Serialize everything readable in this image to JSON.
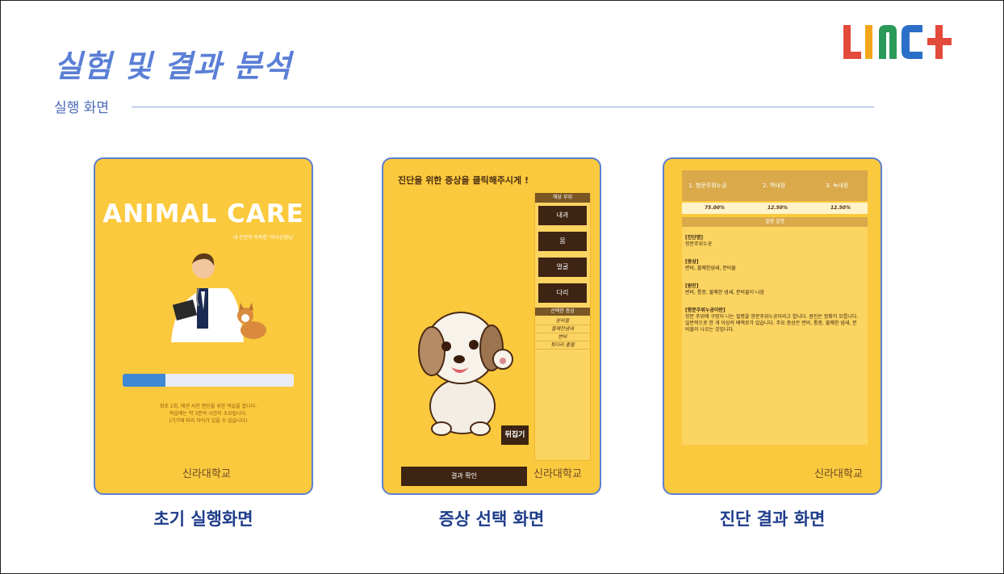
{
  "slide": {
    "title": "실험 및 결과 분석",
    "subtitle": "실행 화면",
    "logo_text": "LINC+"
  },
  "phones": [
    {
      "caption": "초기 실행화면",
      "app_title": "ANIMAL CARE",
      "tagline": "내 손안의 똑똑한 '의사선생님'",
      "progress": 0.25,
      "notes": [
        "최초 1회, 애견 사진 판단을 위한 학습을 합니다.",
        "학습에는 약 3분의 시간이 소요됩니다.",
        "(기기에 따라 차이가 있을 수 있습니다)"
      ],
      "school": "신라대학교"
    },
    {
      "caption": "증상 선택 화면",
      "heading": "진단을 위한 증상을 클릭해주시게 !",
      "part_header": "해당 부위",
      "parts": [
        "내과",
        "몸",
        "얼굴",
        "다리"
      ],
      "symptom_header": "선택한 증상",
      "symptoms": [
        "분비물",
        "불쾌한냄새",
        "변비",
        "뒷다리 출혈"
      ],
      "flip_label": "뒤집기",
      "result_button": "결과 확인",
      "school": "신라대학교"
    },
    {
      "caption": "진단 결과 화면",
      "ranks": [
        "1. 항문주위누공",
        "2. 백내장",
        "3. 녹내장"
      ],
      "probabilities": [
        "75.00%",
        "12.50%",
        "12.50%"
      ],
      "desc_header": "질병 설명",
      "sections": [
        {
          "title": "[진단명]",
          "body": "항문주위누공"
        },
        {
          "title": "[증상]",
          "body": "변비, 불쾌한냄새, 분비물"
        },
        {
          "title": "[원인]",
          "body": "변비, 통증, 불쾌한 냄새, 분비물이 나옴"
        },
        {
          "title": "[항문주위누공이란]",
          "body": "항문 주위에 구멍이 나는 질병을 항문주위누공이라고 합니다. 원인은 정확히 모릅니다. 일반적으로 한 개 이상의 배액로가 있습니다. 주요 증상은 변비, 통증, 불쾌한 냄새, 분비물이 나오는 것입니다."
        }
      ],
      "school": "신라대학교"
    }
  ]
}
